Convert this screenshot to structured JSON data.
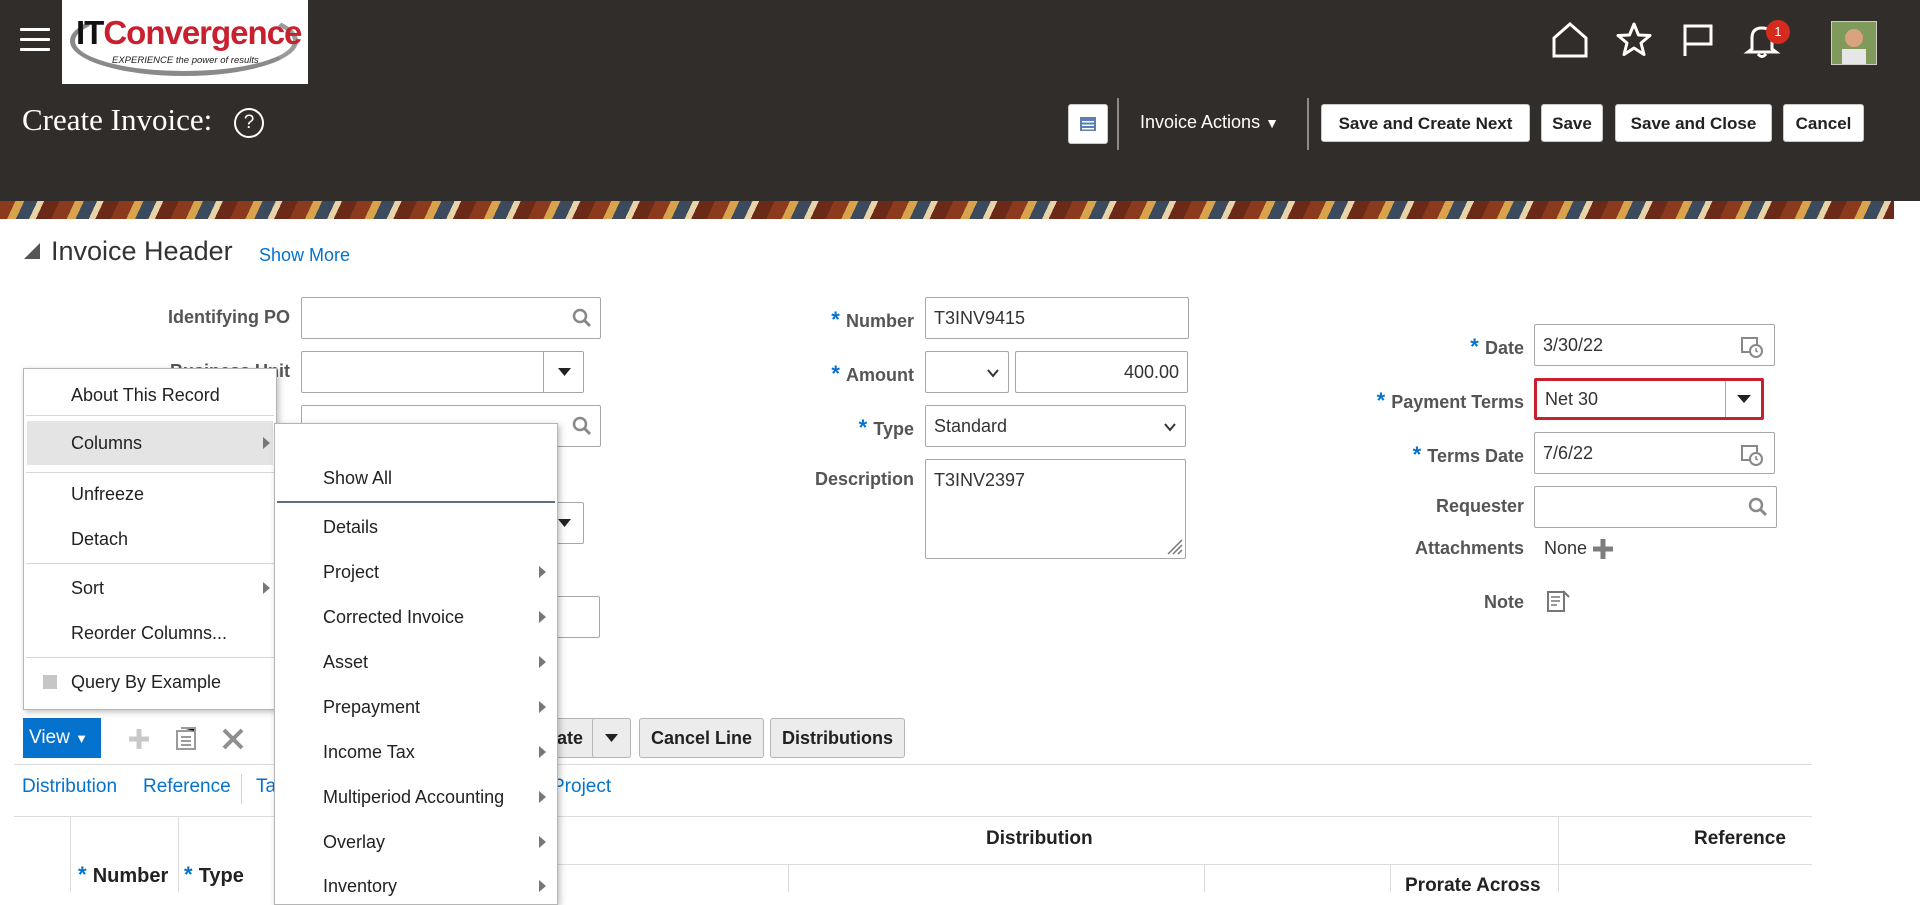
{
  "brand": {
    "logo_main_1": "IT",
    "logo_main_2": "Convergence",
    "logo_tagline": "EXPERIENCE the power of results"
  },
  "header": {
    "title": "Create Invoice:",
    "help": "?",
    "notification_count": "1",
    "actions_menu": "Invoice Actions",
    "buttons": {
      "save_create_next": "Save and Create Next",
      "save": "Save",
      "save_close": "Save and Close",
      "cancel": "Cancel"
    }
  },
  "invoice_header": {
    "title": "Invoice Header",
    "show_more": "Show More",
    "fields": {
      "identifying_po": {
        "label": "Identifying PO",
        "value": ""
      },
      "business_unit": {
        "label": "Business Unit",
        "value": ""
      },
      "number": {
        "label": "Number",
        "value": "T3INV9415"
      },
      "amount": {
        "label": "Amount",
        "currency": "",
        "value": "400.00"
      },
      "type": {
        "label": "Type",
        "value": "Standard"
      },
      "description": {
        "label": "Description",
        "value": "T3INV2397"
      },
      "date": {
        "label": "Date",
        "value": "3/30/22"
      },
      "payment_terms": {
        "label": "Payment Terms",
        "value": "Net 30"
      },
      "terms_date": {
        "label": "Terms Date",
        "value": "7/6/22"
      },
      "requester": {
        "label": "Requester",
        "value": ""
      },
      "attachments": {
        "label": "Attachments",
        "value": "None"
      },
      "note": {
        "label": "Note"
      }
    }
  },
  "context_menu": {
    "items": [
      "About This Record",
      "Columns",
      "Unfreeze",
      "Detach",
      "Sort",
      "Reorder Columns...",
      "Query By Example"
    ]
  },
  "columns_submenu": {
    "items": [
      "Show All",
      "Details",
      "Project",
      "Corrected Invoice",
      "Asset",
      "Prepayment",
      "Income Tax",
      "Multiperiod Accounting",
      "Overlay",
      "Inventory"
    ]
  },
  "lines_toolbar": {
    "view": "View",
    "generate_partial": "ate",
    "cancel_line": "Cancel Line",
    "distributions": "Distributions"
  },
  "line_tabs": [
    "Distribution",
    "Reference",
    "Ta",
    "Project"
  ],
  "table": {
    "group_headers": [
      "Distribution",
      "Reference"
    ],
    "columns": [
      "Number",
      "Type",
      "Prorate Across"
    ]
  },
  "colors": {
    "topbar": "#312d2a",
    "accent": "#0572ce",
    "view_button": "#0572ce",
    "error_outline": "#c8202f"
  }
}
